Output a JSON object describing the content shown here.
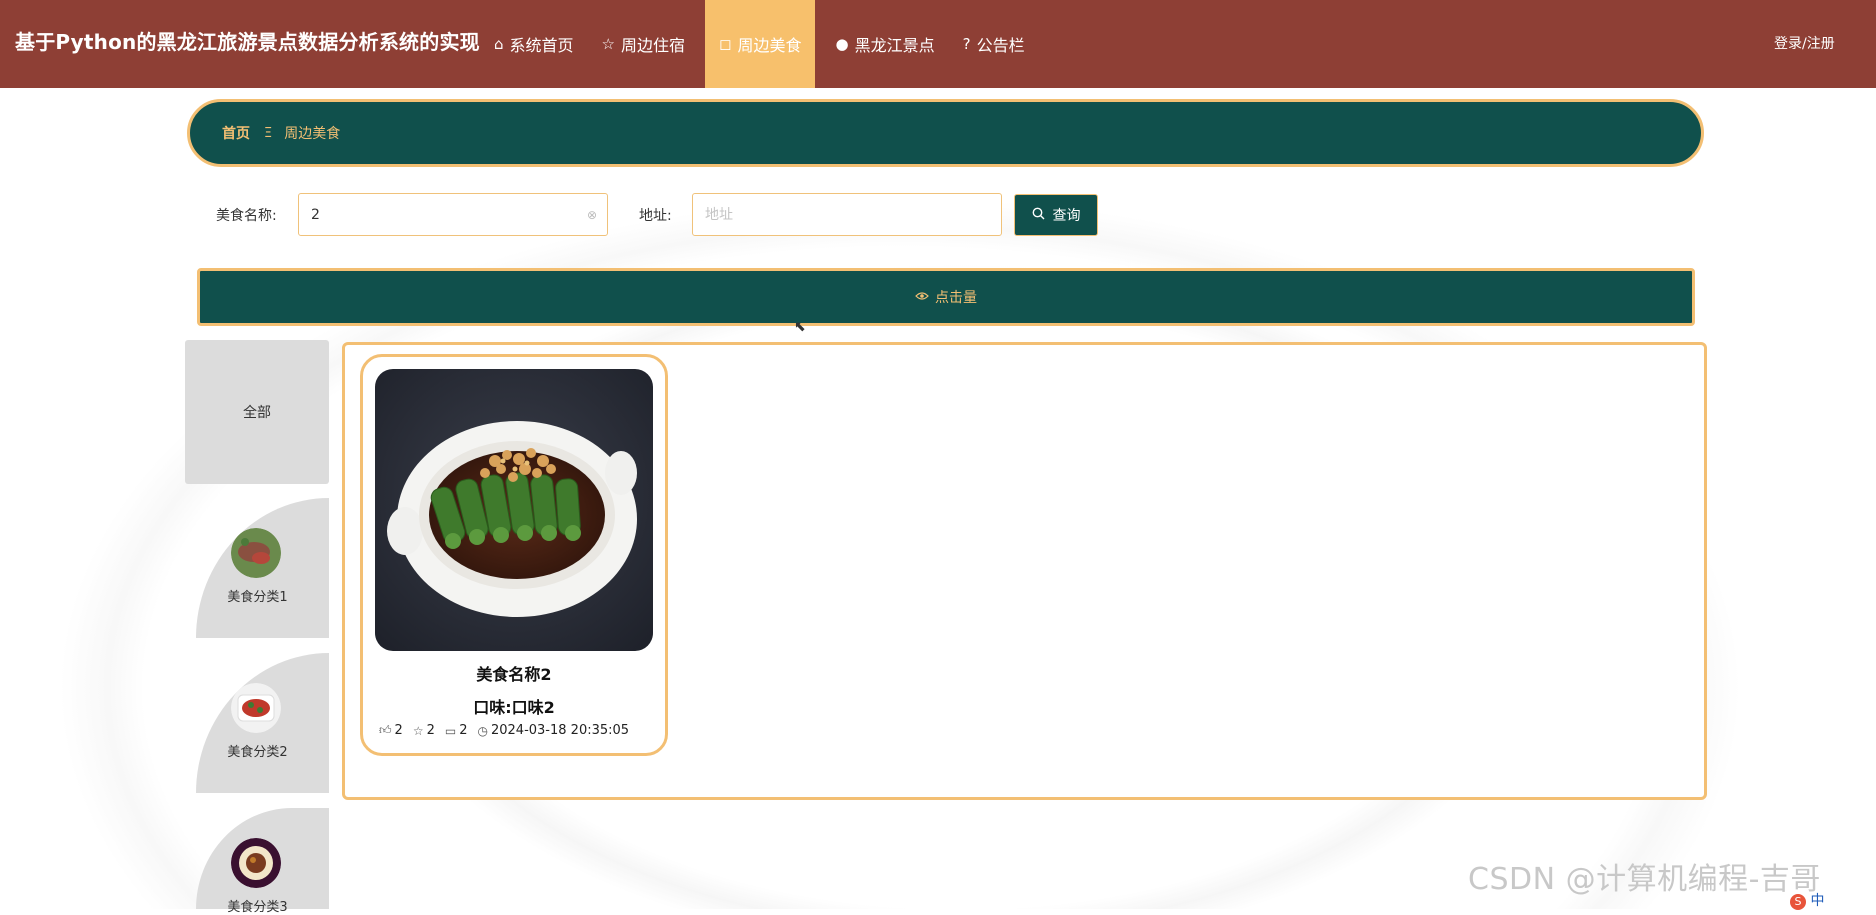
{
  "header": {
    "site_title": "基于Python的黑龙江旅游景点数据分析系统的实现",
    "nav": [
      {
        "label": "系统首页",
        "icon": "home-icon",
        "glyph": "⌂"
      },
      {
        "label": "周边住宿",
        "icon": "star-icon",
        "glyph": "☆"
      },
      {
        "label": "周边美食",
        "icon": "bag-icon",
        "glyph": "◻"
      },
      {
        "label": "黑龙江景点",
        "icon": "clock-icon",
        "glyph": "●"
      },
      {
        "label": "公告栏",
        "icon": "question-icon",
        "glyph": "?"
      }
    ],
    "active_nav": "周边美食",
    "login_label": "登录/注册"
  },
  "breadcrumb": {
    "home": "首页",
    "separator": "Ξ",
    "current": "周边美食"
  },
  "search": {
    "name_label": "美食名称:",
    "name_value": "2",
    "address_label": "地址:",
    "address_placeholder": "地址",
    "button_label": "查询"
  },
  "sort": {
    "label": "点击量"
  },
  "categories": {
    "all_label": "全部",
    "items": [
      {
        "label": "美食分类1"
      },
      {
        "label": "美食分类2"
      },
      {
        "label": "美食分类3"
      }
    ]
  },
  "foods": [
    {
      "name": "美食名称2",
      "taste": "口味:口味2",
      "likes": "2",
      "favorites": "2",
      "comments": "2",
      "time": "2024-03-18 20:35:05"
    }
  ],
  "watermark": "CSDN @计算机编程-吉哥",
  "ime": "中",
  "colors": {
    "header_bg": "#8e3f35",
    "accent_gold": "#f3bf73",
    "dark_teal": "#10504c",
    "active_nav_bg": "#f7c06c"
  }
}
